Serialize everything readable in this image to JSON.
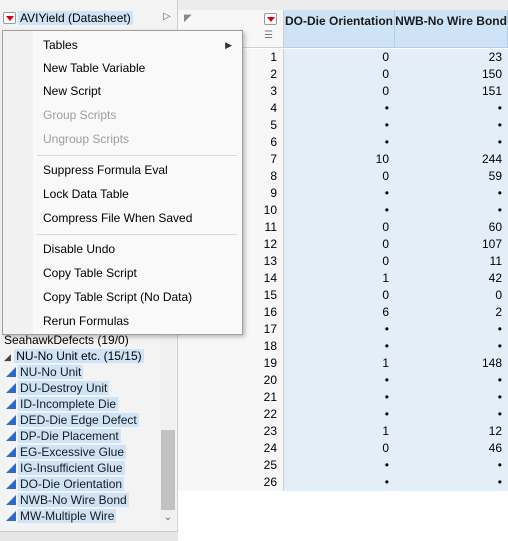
{
  "panel": {
    "title": "AVIYield (Datasheet)"
  },
  "menu": {
    "items": [
      {
        "label": "Tables"
      },
      {
        "label": "New Table Variable"
      },
      {
        "label": "New Script"
      },
      {
        "label": "Group Scripts"
      },
      {
        "label": "Ungroup Scripts"
      },
      {
        "label": "Suppress Formula Eval"
      },
      {
        "label": "Lock Data Table"
      },
      {
        "label": "Compress File When Saved"
      },
      {
        "label": "Disable Undo"
      },
      {
        "label": "Copy Table Script"
      },
      {
        "label": "Copy Table Script (No Data)"
      },
      {
        "label": "Rerun Formulas"
      }
    ]
  },
  "tree": {
    "groups": [
      {
        "label": "SeahawkDefects (19/0)"
      },
      {
        "label": "NU-No Unit etc. (15/15)"
      }
    ],
    "columns": [
      {
        "label": "NU-No Unit"
      },
      {
        "label": "DU-Destroy Unit"
      },
      {
        "label": "ID-Incomplete Die"
      },
      {
        "label": "DED-Die Edge Defect"
      },
      {
        "label": "DP-Die Placement"
      },
      {
        "label": "EG-Excessive Glue"
      },
      {
        "label": "IG-Insufficient Glue"
      },
      {
        "label": "DO-Die Orientation"
      },
      {
        "label": "NWB-No Wire Bond"
      },
      {
        "label": "MW-Multiple Wire"
      }
    ]
  },
  "table": {
    "headers": [
      "DO-Die Orientation",
      "NWB-No Wire Bond"
    ],
    "rows": [
      {
        "n": "1",
        "do": "0",
        "nwb": "23"
      },
      {
        "n": "2",
        "do": "0",
        "nwb": "150"
      },
      {
        "n": "3",
        "do": "0",
        "nwb": "151"
      },
      {
        "n": "4",
        "do": "•",
        "nwb": "•"
      },
      {
        "n": "5",
        "do": "•",
        "nwb": "•"
      },
      {
        "n": "6",
        "do": "•",
        "nwb": "•"
      },
      {
        "n": "7",
        "do": "10",
        "nwb": "244"
      },
      {
        "n": "8",
        "do": "0",
        "nwb": "59"
      },
      {
        "n": "9",
        "do": "•",
        "nwb": "•"
      },
      {
        "n": "10",
        "do": "•",
        "nwb": "•"
      },
      {
        "n": "11",
        "do": "0",
        "nwb": "60"
      },
      {
        "n": "12",
        "do": "0",
        "nwb": "107"
      },
      {
        "n": "13",
        "do": "0",
        "nwb": "11"
      },
      {
        "n": "14",
        "do": "1",
        "nwb": "42"
      },
      {
        "n": "15",
        "do": "0",
        "nwb": "0"
      },
      {
        "n": "16",
        "do": "6",
        "nwb": "2"
      },
      {
        "n": "17",
        "do": "•",
        "nwb": "•"
      },
      {
        "n": "18",
        "do": "•",
        "nwb": "•"
      },
      {
        "n": "19",
        "do": "1",
        "nwb": "148"
      },
      {
        "n": "20",
        "do": "•",
        "nwb": "•"
      },
      {
        "n": "21",
        "do": "•",
        "nwb": "•"
      },
      {
        "n": "22",
        "do": "•",
        "nwb": "•"
      },
      {
        "n": "23",
        "do": "1",
        "nwb": "12"
      },
      {
        "n": "24",
        "do": "0",
        "nwb": "46"
      },
      {
        "n": "25",
        "do": "•",
        "nwb": "•"
      },
      {
        "n": "26",
        "do": "•",
        "nwb": "•"
      }
    ]
  }
}
